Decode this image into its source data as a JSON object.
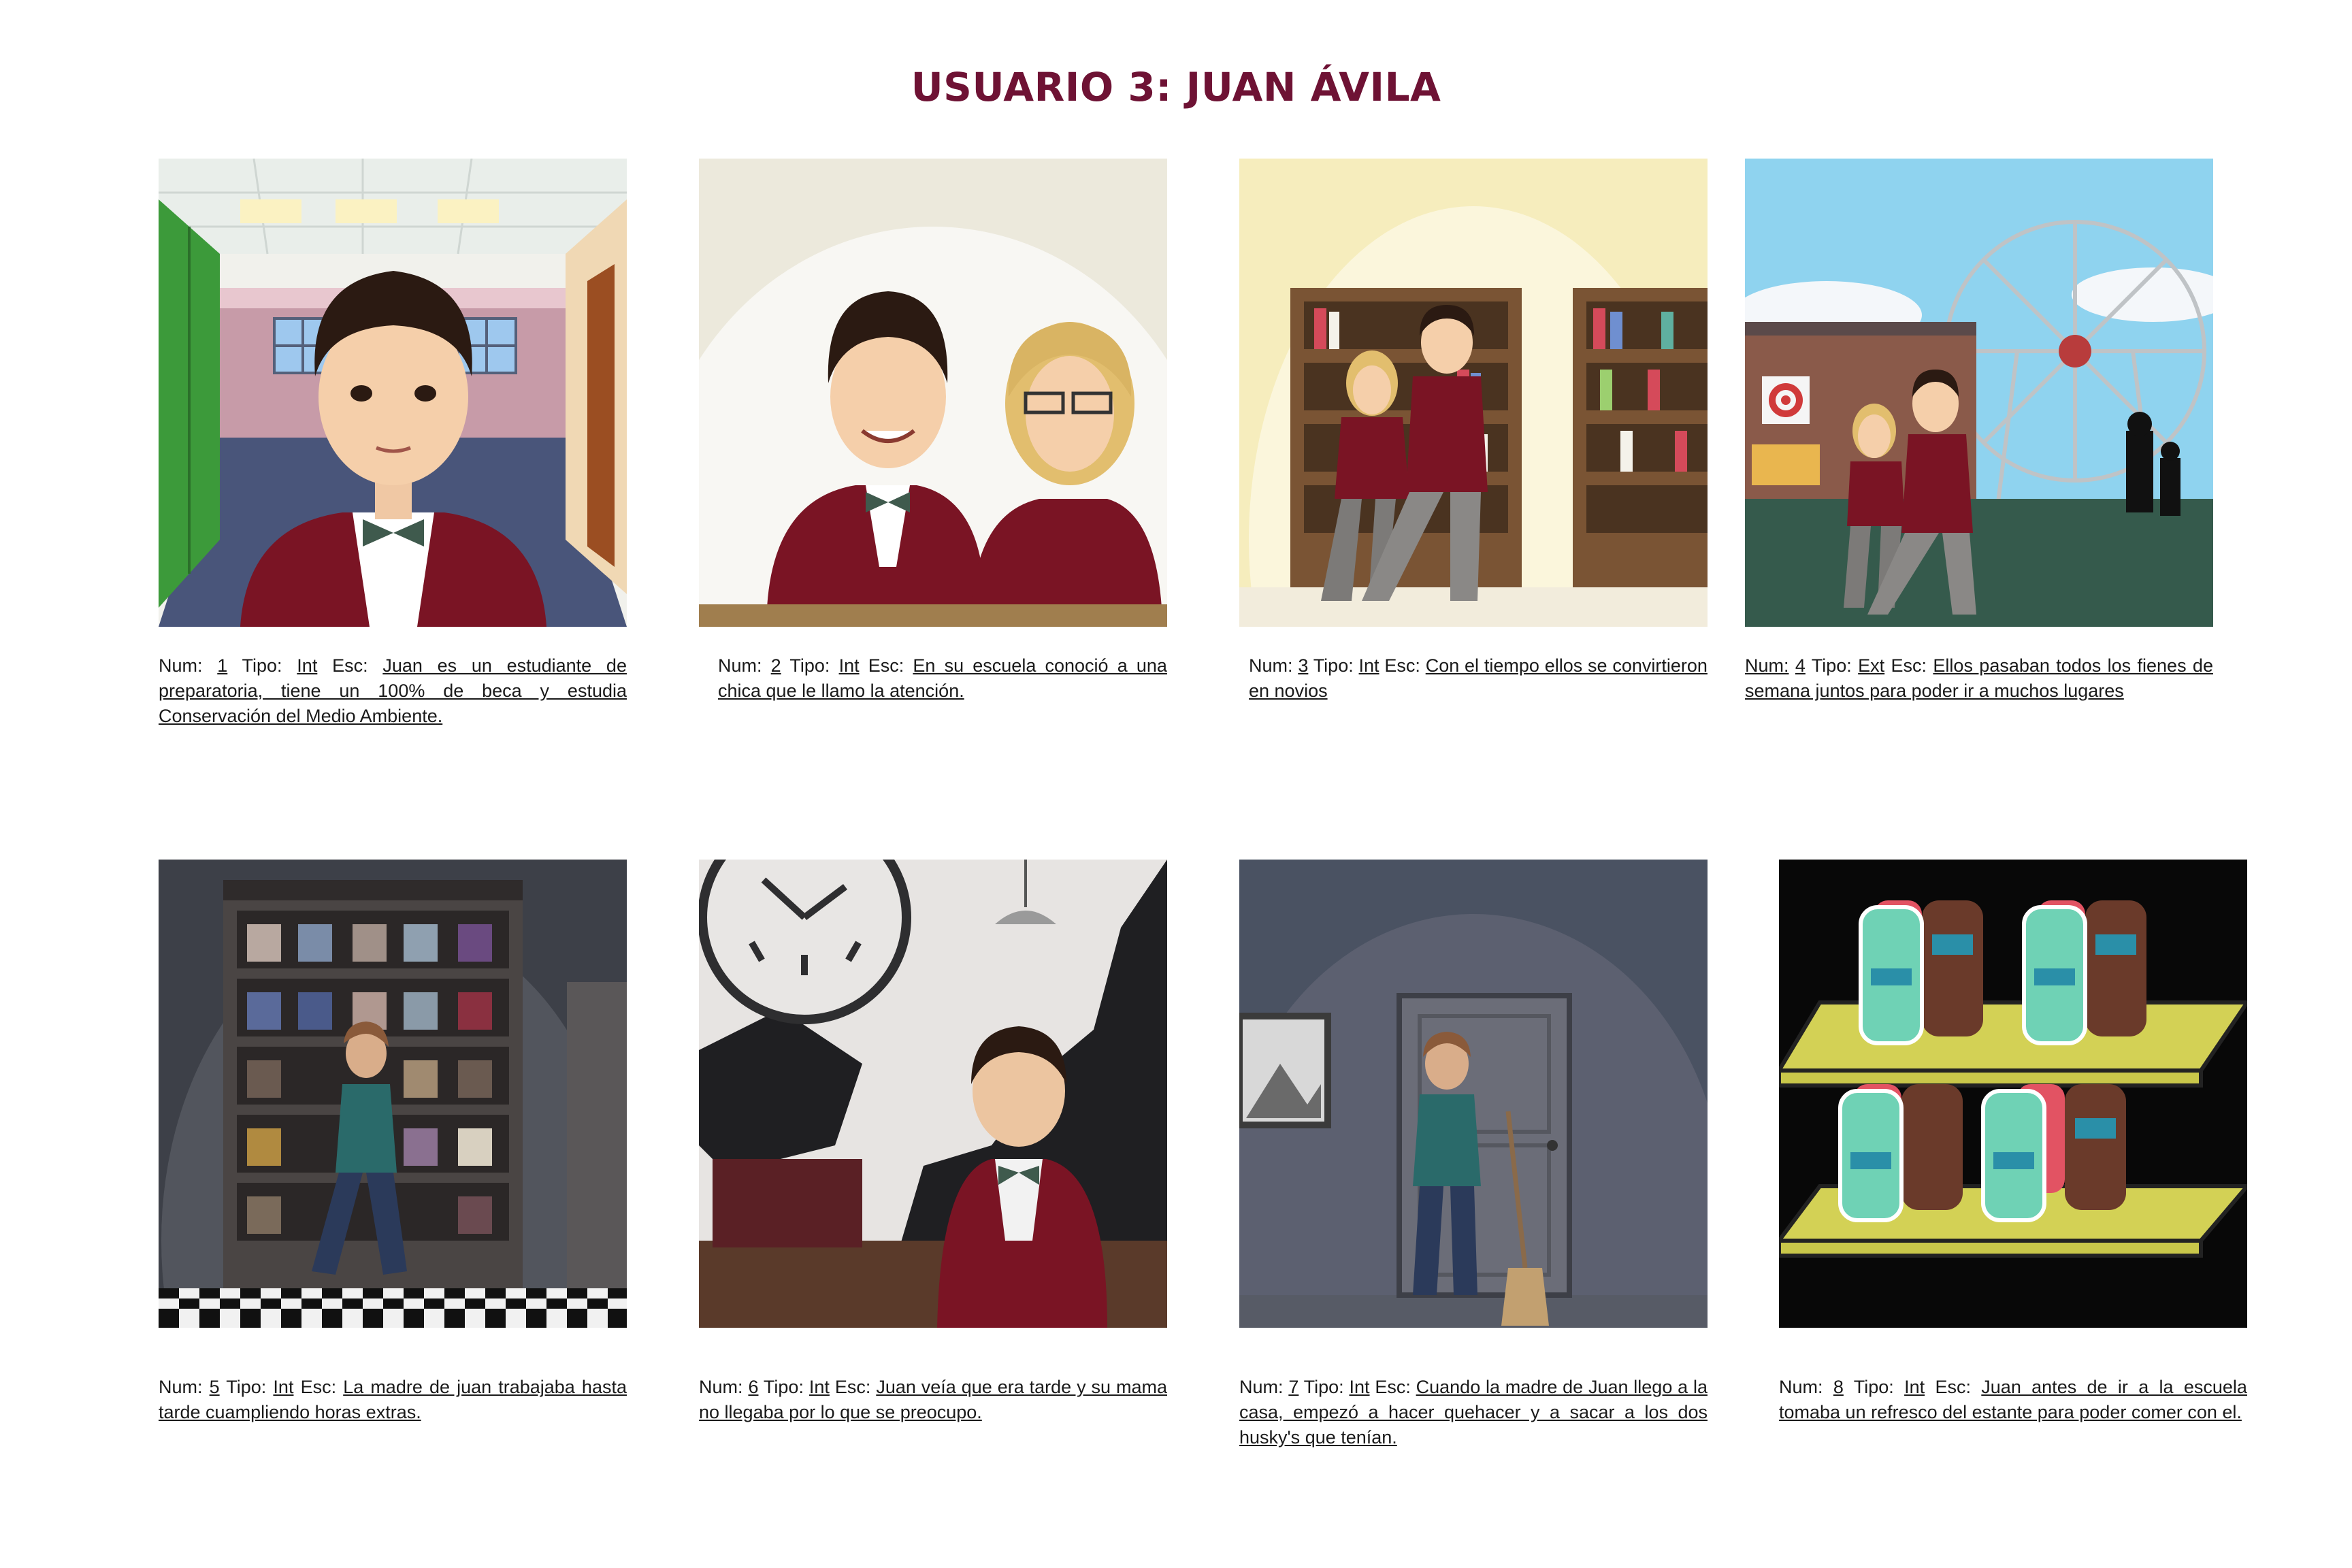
{
  "title": "USUARIO 3: JUAN ÁVILA",
  "labels": {
    "num": "Num:",
    "tipo": "Tipo:",
    "esc": "Esc:"
  },
  "scenes": [
    {
      "num": "1",
      "tipo": "Int",
      "esc": "Juan es un estudiante de preparatoria, tiene un 100% de beca y estudia Conservación del Medio Ambiente.",
      "setting": "hallway"
    },
    {
      "num": "2",
      "tipo": "Int",
      "esc": "En su escuela conoció a una chica que le llamo la atención.",
      "setting": "school"
    },
    {
      "num": "3",
      "tipo": "Int",
      "esc": "Con el tiempo ellos se convirtieron en novios",
      "setting": "library"
    },
    {
      "num": "4",
      "tipo": "Ext",
      "esc": "Ellos pasaban todos los fienes de semana juntos para poder ir a muchos lugares",
      "setting": "fair"
    },
    {
      "num": "5",
      "tipo": "Int",
      "esc": "La madre de juan trabajaba hasta tarde cuampliendo horas extras.",
      "setting": "store"
    },
    {
      "num": "6",
      "tipo": "Int",
      "esc": "Juan veía que era tarde y su mama no llegaba por lo que se preocupo.",
      "setting": "living-room"
    },
    {
      "num": "7",
      "tipo": "Int",
      "esc": "Cuando la madre de Juan llego a la casa, empezó a hacer quehacer y a sacar a los dos husky's que tenían.",
      "setting": "house"
    },
    {
      "num": "8",
      "tipo": "Int",
      "esc": "Juan antes de ir a la escuela tomaba un refresco del estante para poder comer con el.",
      "setting": "shelf"
    }
  ],
  "colors": {
    "title": "#6e1234",
    "sweater": "#7a1424",
    "bowtie": "#3f5a4d"
  }
}
